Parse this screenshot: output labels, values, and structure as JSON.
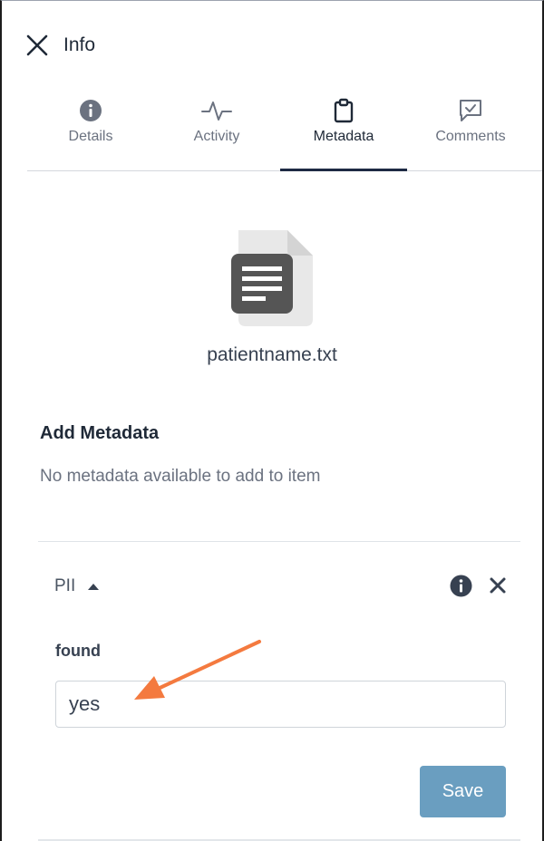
{
  "header": {
    "title": "Info",
    "close_icon": "close-icon"
  },
  "tabs": [
    {
      "label": "Details",
      "icon": "info-circle-icon",
      "active": false
    },
    {
      "label": "Activity",
      "icon": "activity-pulse-icon",
      "active": false
    },
    {
      "label": "Metadata",
      "icon": "clipboard-icon",
      "active": true
    },
    {
      "label": "Comments",
      "icon": "comment-check-icon",
      "active": false
    }
  ],
  "file": {
    "name": "patientname.txt",
    "icon": "text-file-icon"
  },
  "add_metadata": {
    "title": "Add Metadata",
    "empty_message": "No metadata available to add to item"
  },
  "metadata_group": {
    "name": "PII",
    "expanded": true,
    "fields": [
      {
        "label": "found",
        "value": "yes"
      }
    ],
    "save_label": "Save"
  },
  "colors": {
    "active_tab_underline": "#1e2a44",
    "save_button": "#6a9ec0",
    "annotation_arrow": "#f47a3f"
  }
}
